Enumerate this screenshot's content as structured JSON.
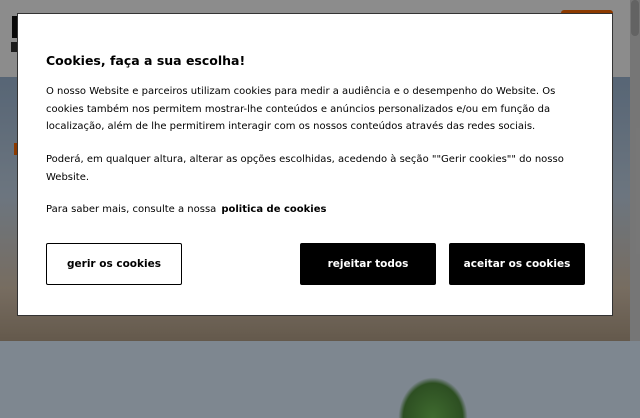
{
  "cookie_modal": {
    "title": "Cookies, faça a sua escolha!",
    "paragraph_1": "O nosso Website e parceiros utilizam cookies para medir a audiência e o desempenho do Website. Os cookies também nos permitem mostrar-lhe conteúdos e anúncios personalizados e/ou em função da localização, além de lhe permitirem interagir com os nossos conteúdos através das redes sociais.",
    "paragraph_2": "Poderá, em qualquer altura, alterar as opções escolhidas, acedendo à seção \"\"Gerir cookies\"\" do nosso Website.",
    "paragraph_3": "Para saber mais, consulte a nossa",
    "policy_link": "politica de cookies",
    "buttons": {
      "manage": "gerir os cookies",
      "reject": "rejeitar todos",
      "accept": "aceitar os cookies"
    }
  },
  "colors": {
    "accent": "#ff6a00",
    "button_dark": "#000000",
    "overlay": "rgba(0,0,0,0.45)"
  }
}
